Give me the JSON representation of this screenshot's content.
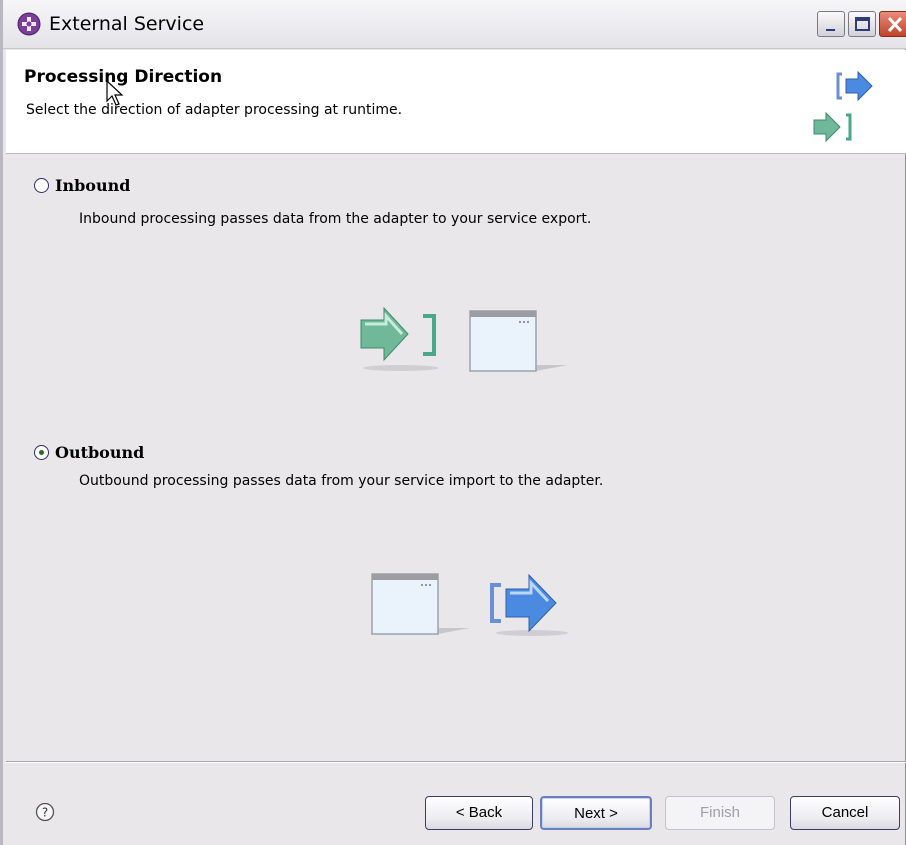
{
  "window": {
    "title": "External Service"
  },
  "header": {
    "title": "Processing Direction",
    "subtitle": "Select the direction of adapter processing at runtime."
  },
  "options": [
    {
      "label": "Inbound",
      "description": "Inbound processing passes data from the adapter to your service export.",
      "selected": false
    },
    {
      "label": "Outbound",
      "description": "Outbound processing passes data from your service import to the adapter.",
      "selected": true
    }
  ],
  "buttons": {
    "back": "< Back",
    "next": "Next >",
    "finish": "Finish",
    "cancel": "Cancel"
  },
  "icons": [
    "app-icon",
    "minimize-icon",
    "maximize-icon",
    "close-icon",
    "processing-direction-icon",
    "inbound-arrow-icon",
    "service-window-icon",
    "outbound-arrow-icon",
    "help-icon",
    "mouse-cursor-icon"
  ],
  "colors": {
    "background": "#e9e7ea",
    "header_background": "#ffffff",
    "arrow_green": "#6fb89a",
    "arrow_blue": "#4a8ae0"
  }
}
